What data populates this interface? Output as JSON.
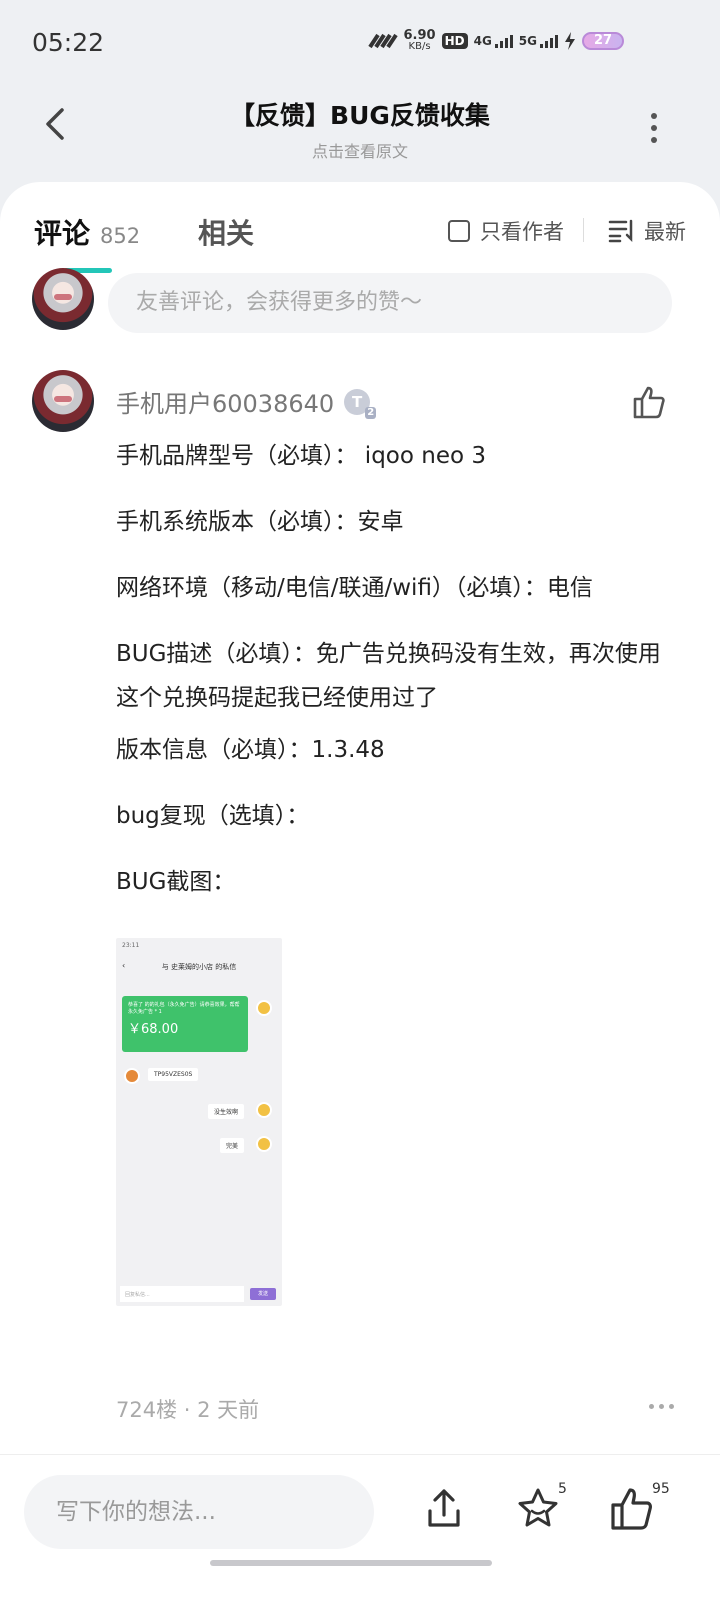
{
  "status_bar": {
    "time": "05:22",
    "net_speed_value": "6.90",
    "net_speed_unit": "KB/s",
    "hd_label": "HD",
    "net1": "4G",
    "net2": "5G",
    "battery": "27"
  },
  "header": {
    "title": "【反馈】BUG反馈收集",
    "subtitle": "点击查看原文"
  },
  "tabs": {
    "comments_label": "评论",
    "comments_count": "852",
    "related_label": "相关",
    "author_only_label": "只看作者",
    "sort_label": "最新"
  },
  "comment_input": {
    "placeholder": "友善评论，会获得更多的赞～"
  },
  "comment": {
    "author": "手机用户60038640",
    "level_letter": "T",
    "level_number": "2",
    "lines": [
      "手机品牌型号（必填）： iqoo neo 3",
      "手机系统版本（必填）：安卓",
      "网络环境（移动/电信/联通/wifi）（必填）：电信",
      "BUG描述（必填）：免广告兑换码没有生效，再次使用这个兑换码提起我已经使用过了",
      "版本信息（必填）：1.3.48",
      "bug复现（选填）：",
      "BUG截图："
    ],
    "floor_meta": "724楼 · 2 天前"
  },
  "screenshot": {
    "time": "23:11",
    "title": "与 史莱姆的小店 的私信",
    "green_text": "恭喜了 的的礼包（永久免广告）请恭喜效果，帮帮永久免广告 * 1",
    "green_price": "￥68.00",
    "code": "TP95VZES0S",
    "reply1": "没生效啊",
    "reply2": "完美",
    "input_placeholder": "回复私信...",
    "send": "发送"
  },
  "bottom_bar": {
    "placeholder": "写下你的想法...",
    "star_count": "5",
    "like_count": "95"
  }
}
